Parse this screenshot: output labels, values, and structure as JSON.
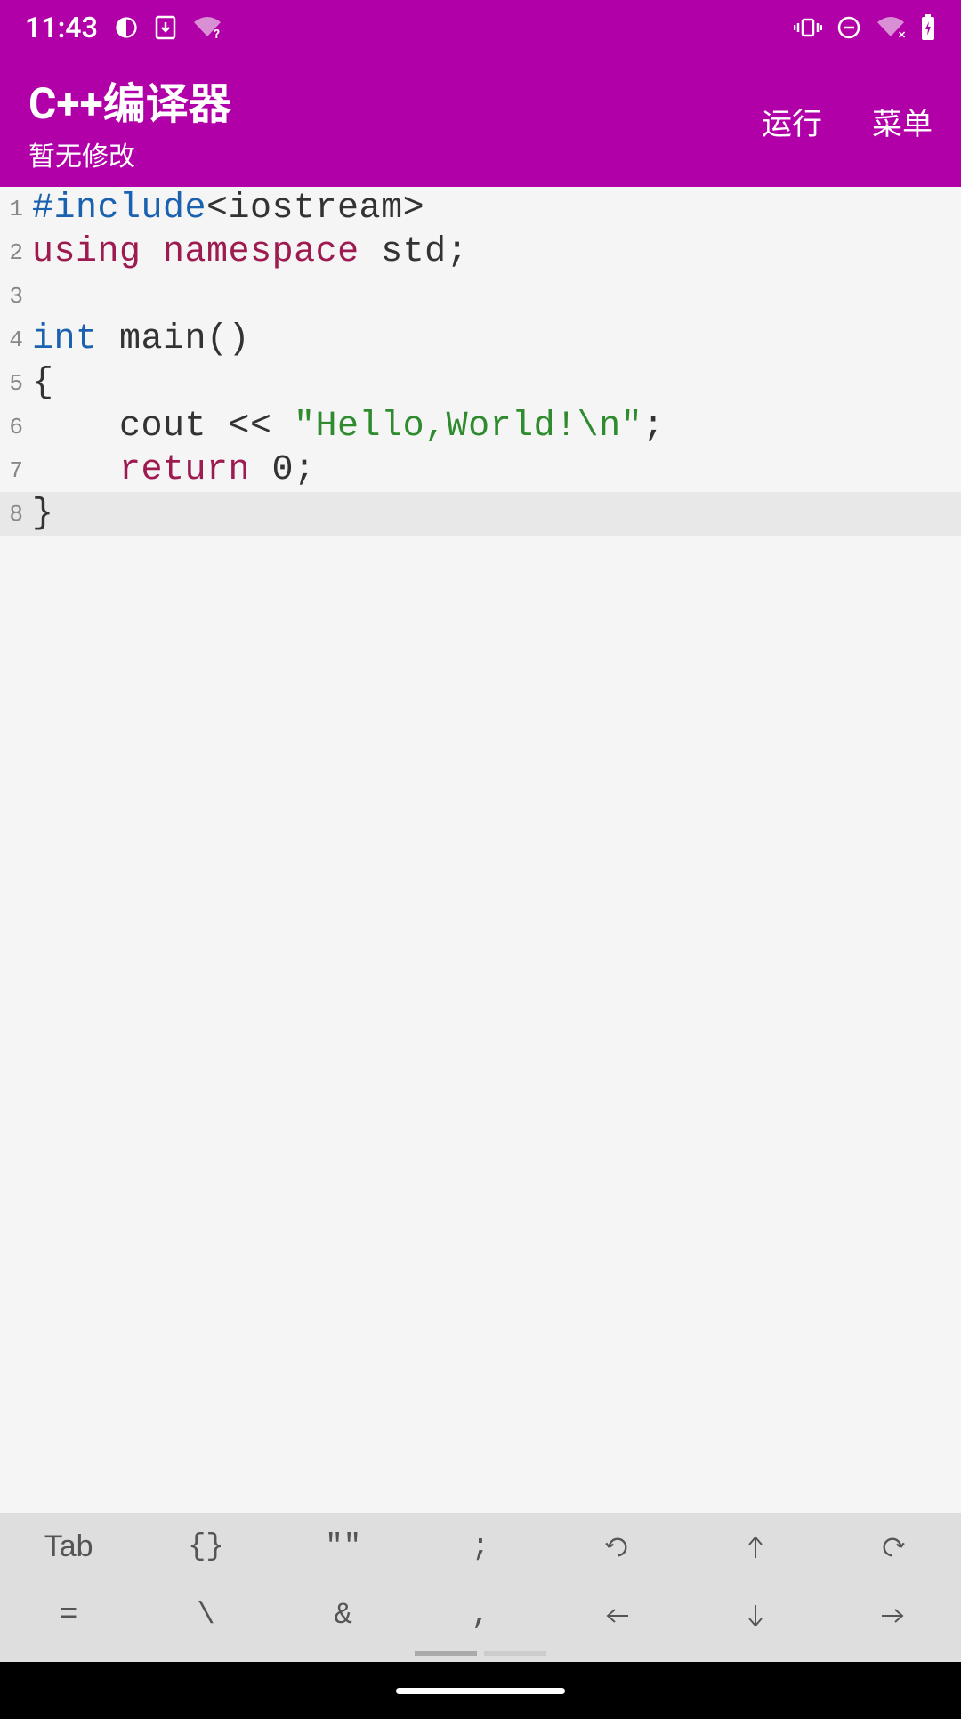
{
  "status": {
    "time": "11:43"
  },
  "header": {
    "title": "C++编译器",
    "subtitle": "暂无修改",
    "run_label": "运行",
    "menu_label": "菜单"
  },
  "code": {
    "lines": [
      {
        "num": "1",
        "tokens": [
          {
            "cls": "tok-preprocessor",
            "t": "#include"
          },
          {
            "cls": "tok-default",
            "t": "<iostream>"
          }
        ]
      },
      {
        "num": "2",
        "tokens": [
          {
            "cls": "tok-keyword",
            "t": "using"
          },
          {
            "cls": "tok-default",
            "t": " "
          },
          {
            "cls": "tok-keyword",
            "t": "namespace"
          },
          {
            "cls": "tok-default",
            "t": " std;"
          }
        ]
      },
      {
        "num": "3",
        "tokens": []
      },
      {
        "num": "4",
        "tokens": [
          {
            "cls": "tok-type",
            "t": "int"
          },
          {
            "cls": "tok-default",
            "t": " main()"
          }
        ]
      },
      {
        "num": "5",
        "tokens": [
          {
            "cls": "tok-default",
            "t": "{"
          }
        ]
      },
      {
        "num": "6",
        "tokens": [
          {
            "cls": "tok-default",
            "t": "    cout << "
          },
          {
            "cls": "tok-string",
            "t": "\"Hello,World!\\n\""
          },
          {
            "cls": "tok-default",
            "t": ";"
          }
        ]
      },
      {
        "num": "7",
        "tokens": [
          {
            "cls": "tok-default",
            "t": "    "
          },
          {
            "cls": "tok-keyword",
            "t": "return"
          },
          {
            "cls": "tok-default",
            "t": " 0;"
          }
        ]
      },
      {
        "num": "8",
        "tokens": [
          {
            "cls": "tok-default",
            "t": "}"
          }
        ],
        "highlighted": true
      }
    ]
  },
  "keyboard": {
    "row1": [
      "Tab",
      "{}",
      "\"\"",
      ";",
      "↺",
      "⇧",
      "↻"
    ],
    "row2": [
      "=",
      "\\",
      "&",
      ",",
      "⇦",
      "⇩",
      "⇨"
    ]
  },
  "icons": {
    "undo": "↺",
    "redo": "↻",
    "up": "⇧",
    "down": "⇩",
    "left": "⇦",
    "right": "⇨"
  }
}
